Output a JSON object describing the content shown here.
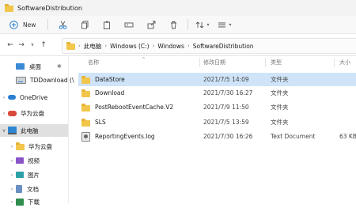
{
  "window": {
    "title": "SoftwareDistribution"
  },
  "toolbar": {
    "new_label": "New",
    "icons": [
      "cut-icon",
      "copy-icon",
      "paste-icon",
      "rename-icon",
      "share-icon",
      "delete-icon",
      "sort-icon",
      "view-icon"
    ]
  },
  "address": {
    "crumbs": [
      "此电脑",
      "Windows (C:)",
      "Windows",
      "SoftwareDistribution"
    ]
  },
  "sidebar": {
    "items": [
      {
        "label": "桌面",
        "icon": "desktop-icon"
      },
      {
        "label": "TDDownload (\\",
        "icon": "drive-icon"
      },
      {
        "label": "OneDrive",
        "icon": "onedrive-icon"
      },
      {
        "label": "华为云盘",
        "icon": "huawei-cloud-icon"
      },
      {
        "label": "此电脑",
        "icon": "computer-icon"
      },
      {
        "label": "华为云盘",
        "icon": "folder-icon"
      },
      {
        "label": "视频",
        "icon": "video-icon"
      },
      {
        "label": "图片",
        "icon": "pictures-icon"
      },
      {
        "label": "文档",
        "icon": "documents-icon"
      },
      {
        "label": "下载",
        "icon": "downloads-icon"
      }
    ]
  },
  "columns": {
    "name": "名称",
    "date": "修改日期",
    "type": "类型",
    "size": "大小"
  },
  "files": [
    {
      "name": "DataStore",
      "date": "2021/7/5 14:09",
      "type": "文件夹",
      "size": "",
      "icon": "folder-icon"
    },
    {
      "name": "Download",
      "date": "2021/7/30 16:27",
      "type": "文件夹",
      "size": "",
      "icon": "folder-icon"
    },
    {
      "name": "PostRebootEventCache.V2",
      "date": "2021/7/9 11:50",
      "type": "文件夹",
      "size": "",
      "icon": "folder-icon"
    },
    {
      "name": "SLS",
      "date": "2021/7/5 13:59",
      "type": "文件夹",
      "size": "",
      "icon": "folder-icon"
    },
    {
      "name": "ReportingEvents.log",
      "date": "2021/7/30 16:26",
      "type": "Text Document",
      "size": "63 KB",
      "icon": "log-file-icon"
    }
  ]
}
